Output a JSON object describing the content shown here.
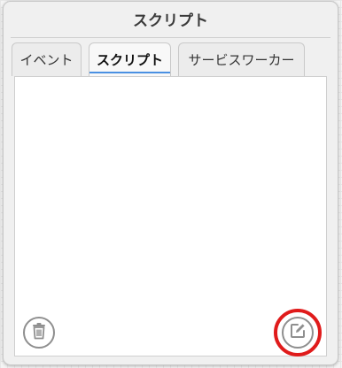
{
  "panel": {
    "title": "スクリプト"
  },
  "tabs": [
    {
      "label": "イベント",
      "active": false
    },
    {
      "label": "スクリプト",
      "active": true
    },
    {
      "label": "サービスワーカー",
      "active": false
    }
  ],
  "script_list": {
    "items": []
  },
  "footer": {
    "delete_icon": "trash-icon",
    "edit_icon": "edit-icon"
  },
  "colors": {
    "active_tab_underline": "#4a90e2",
    "highlight_ring": "#e01b1b",
    "icon_gray": "#8f8f8f"
  }
}
